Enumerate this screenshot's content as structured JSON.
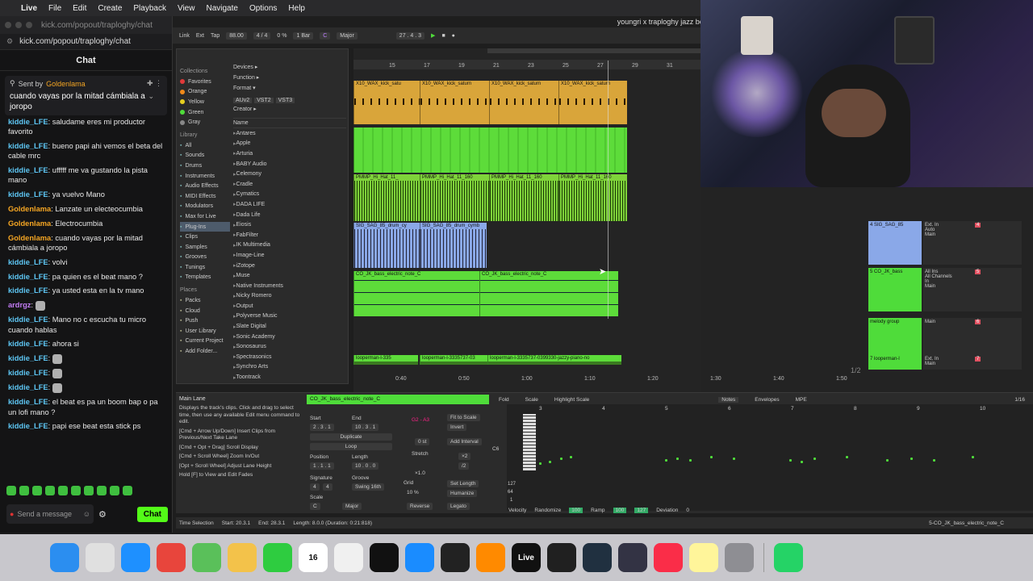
{
  "menubar": {
    "items": [
      "Live",
      "File",
      "Edit",
      "Create",
      "Playback",
      "View",
      "Navigate",
      "Options",
      "Help"
    ]
  },
  "browser_window": {
    "title": "kick.com/popout/traploghy/chat",
    "url": "kick.com/popout/traploghy/chat"
  },
  "chat": {
    "header": "Chat",
    "pinned": {
      "sent_by_label": "Sent by",
      "user": "Goldenlama",
      "text": "cuando vayas por la mitad cámbiala a joropo"
    },
    "messages": [
      {
        "user": "kiddie_LFE",
        "text": "saludame eres mi productor favorito",
        "color": "#5ec7f5"
      },
      {
        "user": "kiddie_LFE",
        "text": "bueno papi ahi vemos el beta del cable mrc",
        "color": "#5ec7f5"
      },
      {
        "user": "kiddie_LFE",
        "text": "ufffff me va gustando la pista mano",
        "color": "#5ec7f5"
      },
      {
        "user": "kiddie_LFE",
        "text": "ya vuelvo Mano",
        "color": "#5ec7f5"
      },
      {
        "user": "Goldenlama",
        "text": "Lanzate un electeocumbia",
        "color": "#f5a623"
      },
      {
        "user": "Goldenlama",
        "text": "Electrocumbia",
        "color": "#f5a623"
      },
      {
        "user": "Goldenlama",
        "text": "cuando vayas por la mitad cámbiala a joropo",
        "color": "#f5a623"
      },
      {
        "user": "kiddie_LFE",
        "text": "volvi",
        "color": "#5ec7f5"
      },
      {
        "user": "kiddie_LFE",
        "text": "pa quien es el beat mano ?",
        "color": "#5ec7f5"
      },
      {
        "user": "kiddie_LFE",
        "text": "ya usted esta en la tv mano",
        "color": "#5ec7f5"
      },
      {
        "user": "ardrgz",
        "text": "",
        "color": "#c27cf5"
      },
      {
        "user": "kiddie_LFE",
        "text": "Mano no c escucha tu micro cuando hablas",
        "color": "#5ec7f5"
      },
      {
        "user": "kiddie_LFE",
        "text": "ahora si",
        "color": "#5ec7f5"
      },
      {
        "user": "kiddie_LFE",
        "text": "",
        "color": "#5ec7f5"
      },
      {
        "user": "kiddie_LFE",
        "text": "",
        "color": "#5ec7f5"
      },
      {
        "user": "kiddie_LFE",
        "text": "",
        "color": "#5ec7f5"
      },
      {
        "user": "kiddie_LFE",
        "text": "el beat es pa un boom bap o pa un lofi mano ?",
        "color": "#5ec7f5"
      },
      {
        "user": "kiddie_LFE",
        "text": "papi ese beat esta stick ps",
        "color": "#5ec7f5"
      }
    ],
    "input_placeholder": "Send a message",
    "send_label": "Chat"
  },
  "live": {
    "title": "youngri x traploghy jazz beat",
    "transport": {
      "link": "Link",
      "ext": "Ext",
      "tap": "Tap",
      "tempo": "88.00",
      "signature": "4 / 4",
      "cpu": "0 %",
      "quantize": "1 Bar",
      "key": "C",
      "scale": "Major",
      "position": "27 .  4 .  3"
    },
    "browser": {
      "collections_label": "Collections",
      "collections": [
        {
          "label": "Favorites",
          "color": "#e03a3a"
        },
        {
          "label": "Orange",
          "color": "#f08a1a"
        },
        {
          "label": "Yellow",
          "color": "#e8d020"
        },
        {
          "label": "Green",
          "color": "#4fdc3a"
        },
        {
          "label": "Gray",
          "color": "#888888"
        }
      ],
      "library_label": "Library",
      "library": [
        "All",
        "Sounds",
        "Drums",
        "Instruments",
        "Audio Effects",
        "MIDI Effects",
        "Modulators",
        "Max for Live",
        "Plug-Ins",
        "Clips",
        "Samples",
        "Grooves",
        "Tunings",
        "Templates"
      ],
      "selected_library": "Plug-Ins",
      "places_label": "Places",
      "places": [
        "Packs",
        "Cloud",
        "Push",
        "User Library",
        "Current Project",
        "Add Folder..."
      ],
      "filters": [
        "Devices ▸",
        "Function ▸",
        "Format ▾",
        "Creator ▸"
      ],
      "formats": [
        "AUv2",
        "VST2",
        "VST3"
      ],
      "name_header": "Name",
      "plugins": [
        "Antares",
        "Apple",
        "Arturia",
        "BABY Audio",
        "Celemony",
        "Cradle",
        "Cymatics",
        "DADA LIFE",
        "Dada Life",
        "Eiosis",
        "FabFilter",
        "IK Multimedia",
        "Image-Line",
        "iZotope",
        "Muse",
        "Native Instruments",
        "Nicky Romero",
        "Output",
        "Polyverse Music",
        "Slate Digital",
        "Sonic Academy",
        "Sonosaurus",
        "Spectrasonics",
        "Synchro Arts",
        "Toontrack"
      ]
    },
    "ruler_top": [
      "15",
      "17",
      "19",
      "21",
      "23",
      "25",
      "27",
      "29",
      "31"
    ],
    "ruler_bottom": [
      "0:40",
      "0:50",
      "1:00",
      "1:10",
      "1:20",
      "1:30",
      "1:40",
      "1:50"
    ],
    "clips": {
      "kick": [
        "X10_WAX_kick_satu",
        "X10_WAX_kick_saturn",
        "X10_WAX_kick_saturn",
        "X10_WAX_kick_saturn"
      ],
      "hats": [
        "PMMP_Hi_Hat_11_",
        "PMMP_Hi_Hat_11_160",
        "PMMP_Hi_Hat_11_160",
        "PMMP_Hi_Hat_11_160"
      ],
      "sig": [
        "SIG_SAG_85_drum_cy",
        "SIG_SAG_85_drum_cymb"
      ],
      "bass": [
        "CO_JK_bass_electric_note_C",
        "CO_JK_bass_electric_note_C"
      ],
      "piano": [
        "looperman-l-335",
        "looperman-l-3335737-03",
        "looperman-l-3335737-0399330-jazzy-piano-no"
      ]
    },
    "tracks": [
      {
        "name": "4 SIG_SAG_85",
        "input": "Ext. In",
        "monitor": "Auto",
        "out": "Main",
        "num": "4",
        "color": "#8aa8e8"
      },
      {
        "name": "5 CO_JK_bass",
        "input": "All Ins",
        "channel": "All Channels",
        "monitor": "In",
        "out": "Main",
        "num": "5",
        "color": "#4fdc3a"
      },
      {
        "name": "melody group",
        "input": "",
        "out": "Main",
        "num": "6",
        "color": "#4fdc3a"
      },
      {
        "name": "7 looperman-l",
        "input": "Ext. In",
        "out": "Main",
        "num": "7",
        "color": "#4fdc3a"
      }
    ],
    "page_indicator": "1/2",
    "detail": {
      "main_lane_title": "Main Lane",
      "main_lane_text": [
        "Displays the track's clips. Click and drag to select time, then use any available Edit menu command to edit.",
        "[Cmd + Arrow Up/Down] Insert Clips from Previous/Next Take Lane",
        "[Cmd + Opt + Drag] Scroll Display",
        "[Cmd + Scroll Wheel] Zoom In/Out",
        "[Opt + Scroll Wheel] Adjust Lane Height",
        "Hold [F] to View and Edit Fades"
      ],
      "clip_name": "CO_JK_bass_electric_note_C",
      "start_label": "Start",
      "end_label": "End",
      "set_label": "Set",
      "start": "2 . 3 . 1",
      "end": "10 . 3 . 1",
      "duplicate": "Duplicate",
      "loop": "Loop",
      "position_label": "Position",
      "length_label": "Length",
      "position": "1 . 1 . 1",
      "length": "10 . 0 . 0",
      "signature_label": "Signature",
      "groove_label": "Groove",
      "sig_num": "4",
      "sig_den": "4",
      "swing": "Swing 16th",
      "scale_label": "Scale",
      "scale_key": "C",
      "scale_name": "Major",
      "range": "G2 - A3",
      "fit_to_scale": "Fit to Scale",
      "invert": "Invert",
      "offset": "0 st",
      "add_interval": "Add Interval",
      "stretch": "Stretch",
      "stretch_val": "×1.0",
      "x2": "×2",
      "div2": "/2",
      "grid_label": "Grid",
      "set_length": "Set Length",
      "grid_pct": "10 %",
      "humanize": "Humanize",
      "reverse": "Reverse",
      "legato": "Legato",
      "fold": "Fold",
      "scale_btn": "Scale",
      "highlight_scale": "Highlight Scale",
      "tabs": [
        "Notes",
        "Envelopes",
        "MPE"
      ],
      "zoom": "1/16",
      "grid_nums": [
        "3",
        "4",
        "5",
        "6",
        "7",
        "8",
        "9",
        "10"
      ],
      "piano_label": "C6",
      "vel_nums": [
        "127",
        "64",
        "1"
      ],
      "velocity": "Velocity",
      "randomize": "Randomize",
      "rand_val": "100",
      "ramp": "Ramp",
      "ramp_val1": "100",
      "ramp_val2": "127",
      "deviation": "Deviation",
      "deviation_val": "0"
    },
    "status": {
      "label": "Time Selection",
      "start": "Start: 20.3.1",
      "end": "End: 28.3.1",
      "length": "Length: 8.0.0  (Duration: 0:21:818)",
      "track": "5-CO_JK_bass_electric_note_C"
    }
  },
  "dock": {
    "items": [
      {
        "name": "finder",
        "color": "#2b8ef0",
        "label": ""
      },
      {
        "name": "launchpad",
        "color": "#e0e0e0",
        "label": ""
      },
      {
        "name": "safari",
        "color": "#1e90ff",
        "label": ""
      },
      {
        "name": "chrome",
        "color": "#e8453c",
        "label": ""
      },
      {
        "name": "maps",
        "color": "#5ac05a",
        "label": ""
      },
      {
        "name": "photos",
        "color": "#f3c24a",
        "label": ""
      },
      {
        "name": "facetime",
        "color": "#2ecc40",
        "label": ""
      },
      {
        "name": "calendar",
        "color": "#ffffff",
        "label": "16"
      },
      {
        "name": "reminders",
        "color": "#f0f0f0",
        "label": ""
      },
      {
        "name": "capcut",
        "color": "#111111",
        "label": ""
      },
      {
        "name": "app-store",
        "color": "#1a8cff",
        "label": ""
      },
      {
        "name": "capcut-2",
        "color": "#222222",
        "label": ""
      },
      {
        "name": "fl-studio",
        "color": "#ff8a00",
        "label": ""
      },
      {
        "name": "ableton-live",
        "color": "#111111",
        "label": "Live"
      },
      {
        "name": "obs",
        "color": "#202020",
        "label": ""
      },
      {
        "name": "app-1",
        "color": "#203040",
        "label": ""
      },
      {
        "name": "app-2",
        "color": "#333344",
        "label": ""
      },
      {
        "name": "music",
        "color": "#fa2d48",
        "label": ""
      },
      {
        "name": "notes",
        "color": "#fff59a",
        "label": ""
      },
      {
        "name": "system-settings",
        "color": "#8e8e93",
        "label": ""
      },
      {
        "name": "whatsapp",
        "color": "#25d366",
        "label": ""
      }
    ]
  }
}
